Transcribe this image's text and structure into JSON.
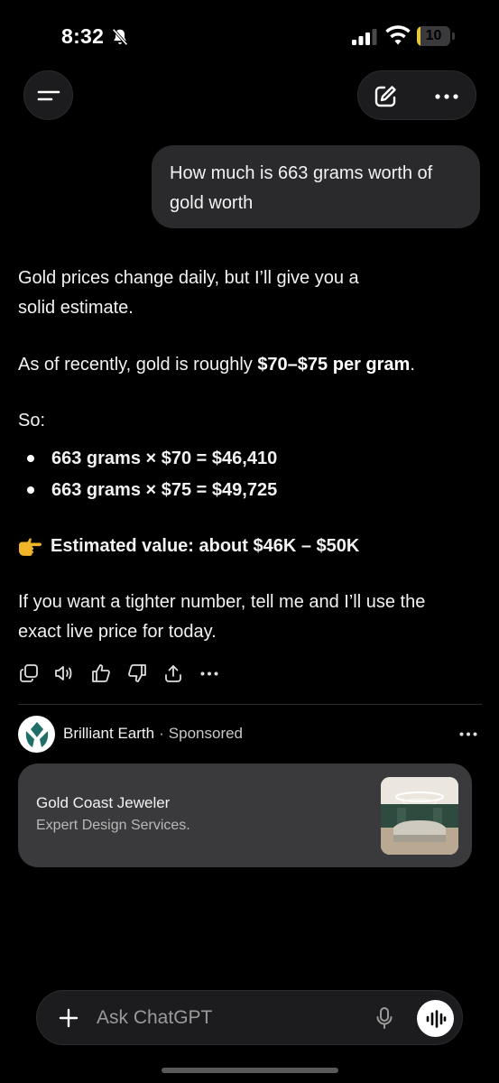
{
  "status_bar": {
    "time": "8:32",
    "battery": "10",
    "battery_level": 0.1
  },
  "header": {
    "menu_icon": "menu-icon",
    "edit_icon": "new-chat-icon",
    "more_icon": "more-icon"
  },
  "user_message": "How much is 663 grams worth of gold worth",
  "assistant": {
    "para1": "Gold prices change daily, but I’ll give you a solid estimate.",
    "para2_prefix": "As of recently, gold is roughly ",
    "para2_bold": "$70–$75 per gram",
    "para2_suffix": ".",
    "para3": "So:",
    "bullets": [
      "663 grams × $70 = $46,410",
      "663 grams × $75 = $49,725"
    ],
    "estimate": "Estimated value: about $46K – $50K",
    "para5": "If you want a tighter number, tell me and I’ll use the exact live price for today."
  },
  "message_actions": [
    "copy-icon",
    "read-aloud-icon",
    "thumbs-up-icon",
    "thumbs-down-icon",
    "share-icon",
    "more-icon"
  ],
  "ad": {
    "brand": "Brilliant Earth",
    "separator": "·",
    "sponsored": "Sponsored",
    "title": "Gold Coast Jeweler",
    "description": "Expert Design Services."
  },
  "composer": {
    "placeholder": "Ask ChatGPT"
  },
  "colors": {
    "background": "#000000",
    "bubble": "#2a2a2c",
    "card": "#3a3a3c",
    "battery": "#e6c63a",
    "logo_teal": "#1f6f68"
  }
}
